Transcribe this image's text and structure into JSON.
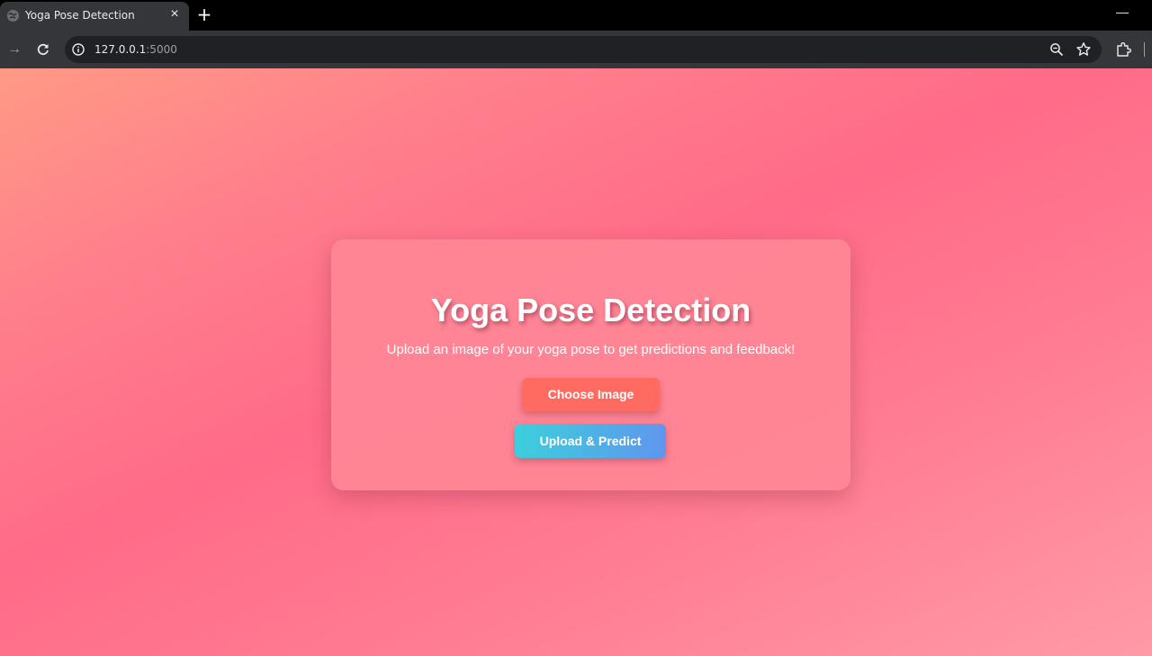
{
  "browser": {
    "tab_title": "Yoga Pose Detection",
    "tab_close": "×",
    "new_tab": "+",
    "minimize": "—",
    "forward": "→",
    "url_host": "127.0.0.1",
    "url_port": ":5000",
    "icons": [
      "globe-icon",
      "close-icon",
      "plus-icon",
      "minimize-icon",
      "forward-arrow-icon",
      "reload-icon",
      "info-icon",
      "zoom-icon",
      "star-icon",
      "extensions-icon"
    ]
  },
  "page": {
    "title": "Yoga Pose Detection",
    "subtitle": "Upload an image of your yoga pose to get predictions and feedback!",
    "choose_button": "Choose Image",
    "upload_button": "Upload & Predict"
  },
  "colors": {
    "background_gradient": [
      "#ff9a85",
      "#ff6b88",
      "#ff9aa7"
    ],
    "card": "#ff8796",
    "choose_button": "#ff6b61",
    "upload_button_gradient": [
      "#3ccfdc",
      "#5f96ee"
    ]
  }
}
